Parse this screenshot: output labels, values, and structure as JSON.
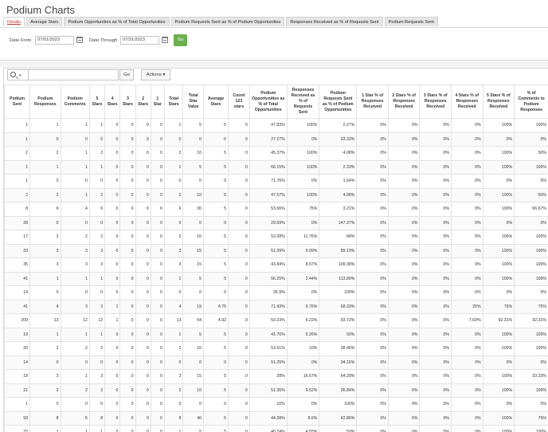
{
  "page": {
    "title": "Podium Charts"
  },
  "tabs": [
    "Details",
    "Average Stars",
    "Podium Opportunities as % of Total Opportunities",
    "Podium Requests Sent as % of Podium Opportunities",
    "Responses Received as % of Requests Sent",
    "Podium Requests Sent"
  ],
  "filters": {
    "date_from_label": "Date From",
    "date_from_value": "07/01/2023",
    "date_through_label": "Date Through",
    "date_through_value": "07/31/2023",
    "go_label": "Go"
  },
  "toolbar": {
    "go_label": "Go",
    "actions_label": "Actions"
  },
  "table": {
    "columns": [
      "Podium Sent",
      "Podium Responses",
      "Podium Comments",
      "5 Stars",
      "4 Stars",
      "3 Stars",
      "2 Stars",
      "1 Star",
      "Total Stars",
      "Total Star Value",
      "Average Stars",
      "Count 123 stars",
      "Podium Opportunities as % of Total Opportunities",
      "Responses Received as % of Requests Sent",
      "Podium Requests Sent as % of Podium Opportunities",
      "1 Star % of Responses Received",
      "2 Stars % of Responses Received",
      "3 Stars % of Responses Received",
      "4 Stars % of Responses Received",
      "5 Stars % of Responses Received",
      "% of Comments to Podium Responses"
    ],
    "rows": [
      [
        "1",
        "1",
        "1",
        "1",
        "0",
        "0",
        "0",
        "0",
        "1",
        "5",
        "5",
        "0",
        "47.83%",
        "100%",
        "2.27%",
        "0%",
        "0%",
        "0%",
        "0%",
        "100%",
        "100%"
      ],
      [
        "1",
        "0",
        "0",
        "0",
        "0",
        "0",
        "0",
        "0",
        "0",
        "0",
        "0",
        "0",
        "27.27%",
        "0%",
        "33.33%",
        "0%",
        "0%",
        "0%",
        "0%",
        "0%",
        "0%"
      ],
      [
        "2",
        "2",
        "1",
        "2",
        "0",
        "0",
        "0",
        "0",
        "2",
        "10",
        "5",
        "0",
        "45.37%",
        "100%",
        "4.08%",
        "0%",
        "0%",
        "0%",
        "0%",
        "100%",
        "50%"
      ],
      [
        "1",
        "1",
        "1",
        "1",
        "0",
        "0",
        "0",
        "0",
        "1",
        "5",
        "5",
        "0",
        "66.15%",
        "100%",
        "2.33%",
        "0%",
        "0%",
        "0%",
        "0%",
        "100%",
        "100%"
      ],
      [
        "1",
        "0",
        "0",
        "0",
        "0",
        "0",
        "0",
        "0",
        "0",
        "0",
        "0",
        "0",
        "71.76%",
        "0%",
        "1.64%",
        "0%",
        "0%",
        "0%",
        "0%",
        "0%",
        "0%"
      ],
      [
        "2",
        "2",
        "1",
        "2",
        "0",
        "0",
        "0",
        "0",
        "2",
        "10",
        "5",
        "0",
        "47.57%",
        "100%",
        "4.08%",
        "0%",
        "0%",
        "0%",
        "0%",
        "100%",
        "50%"
      ],
      [
        "8",
        "6",
        "4",
        "6",
        "0",
        "0",
        "0",
        "0",
        "6",
        "30",
        "5",
        "0",
        "53.66%",
        "75%",
        "3.21%",
        "0%",
        "0%",
        "0%",
        "0%",
        "100%",
        "66.67%"
      ],
      [
        "28",
        "0",
        "0",
        "0",
        "0",
        "0",
        "0",
        "0",
        "0",
        "0",
        "0",
        "0",
        "29.69%",
        "0%",
        "147.37%",
        "0%",
        "0%",
        "0%",
        "0%",
        "0%",
        "0%"
      ],
      [
        "17",
        "2",
        "2",
        "2",
        "0",
        "0",
        "0",
        "0",
        "2",
        "10",
        "5",
        "0",
        "52.08%",
        "11.76%",
        "68%",
        "0%",
        "0%",
        "0%",
        "0%",
        "100%",
        "100%"
      ],
      [
        "33",
        "3",
        "3",
        "3",
        "0",
        "0",
        "0",
        "0",
        "3",
        "15",
        "5",
        "0",
        "51.39%",
        "9.09%",
        "89.19%",
        "0%",
        "0%",
        "0%",
        "0%",
        "100%",
        "100%"
      ],
      [
        "35",
        "3",
        "3",
        "3",
        "0",
        "0",
        "0",
        "0",
        "3",
        "15",
        "5",
        "0",
        "43.84%",
        "8.57%",
        "109.38%",
        "0%",
        "0%",
        "0%",
        "0%",
        "100%",
        "100%"
      ],
      [
        "41",
        "1",
        "1",
        "1",
        "0",
        "0",
        "0",
        "0",
        "1",
        "5",
        "5",
        "0",
        "56.25%",
        "2.44%",
        "113.89%",
        "0%",
        "0%",
        "0%",
        "0%",
        "100%",
        "100%"
      ],
      [
        "14",
        "0",
        "0",
        "0",
        "0",
        "0",
        "0",
        "0",
        "0",
        "0",
        "0",
        "0",
        "35.9%",
        "0%",
        "100%",
        "0%",
        "0%",
        "0%",
        "0%",
        "0%",
        "0%"
      ],
      [
        "41",
        "4",
        "3",
        "3",
        "1",
        "0",
        "0",
        "0",
        "4",
        "19",
        "4.75",
        "0",
        "71.43%",
        "9.76%",
        "68.33%",
        "0%",
        "0%",
        "0%",
        "25%",
        "75%",
        "75%"
      ],
      [
        "209",
        "13",
        "12",
        "12",
        "1",
        "0",
        "0",
        "0",
        "13",
        "64",
        "4.92",
        "0",
        "50.23%",
        "6.22%",
        "93.72%",
        "0%",
        "0%",
        "0%",
        "7.69%",
        "92.31%",
        "92.31%"
      ],
      [
        "19",
        "1",
        "1",
        "1",
        "0",
        "0",
        "0",
        "0",
        "1",
        "5",
        "5",
        "0",
        "41.76%",
        "5.26%",
        "50%",
        "0%",
        "0%",
        "0%",
        "0%",
        "100%",
        "100%"
      ],
      [
        "20",
        "2",
        "2",
        "2",
        "0",
        "0",
        "0",
        "0",
        "2",
        "10",
        "5",
        "0",
        "53.61%",
        "10%",
        "38.46%",
        "0%",
        "0%",
        "0%",
        "0%",
        "100%",
        "100%"
      ],
      [
        "14",
        "0",
        "0",
        "0",
        "0",
        "0",
        "0",
        "0",
        "0",
        "0",
        "0",
        "0",
        "51.25%",
        "0%",
        "34.15%",
        "0%",
        "0%",
        "0%",
        "0%",
        "0%",
        "0%"
      ],
      [
        "18",
        "3",
        "1",
        "3",
        "0",
        "0",
        "0",
        "0",
        "3",
        "15",
        "5",
        "0",
        "28%",
        "16.67%",
        "64.29%",
        "0%",
        "0%",
        "0%",
        "0%",
        "100%",
        "33.33%"
      ],
      [
        "21",
        "2",
        "2",
        "2",
        "0",
        "0",
        "0",
        "0",
        "2",
        "10",
        "5",
        "0",
        "51.35%",
        "9.52%",
        "36.84%",
        "0%",
        "0%",
        "0%",
        "0%",
        "100%",
        "100%"
      ],
      [
        "1",
        "0",
        "0",
        "0",
        "0",
        "0",
        "0",
        "0",
        "0",
        "0",
        "0",
        "0",
        "10%",
        "0%",
        "100%",
        "0%",
        "0%",
        "0%",
        "0%",
        "0%",
        "0%"
      ],
      [
        "93",
        "8",
        "6",
        "8",
        "0",
        "0",
        "0",
        "0",
        "8",
        "40",
        "5",
        "0",
        "44.38%",
        "8.6%",
        "42.86%",
        "0%",
        "0%",
        "0%",
        "0%",
        "100%",
        "75%"
      ],
      [
        "22",
        "1",
        "1",
        "1",
        "0",
        "0",
        "0",
        "0",
        "1",
        "5",
        "5",
        "0",
        "40.74%",
        "4.55%",
        "50%",
        "0%",
        "0%",
        "0%",
        "0%",
        "100%",
        "100%"
      ]
    ]
  }
}
